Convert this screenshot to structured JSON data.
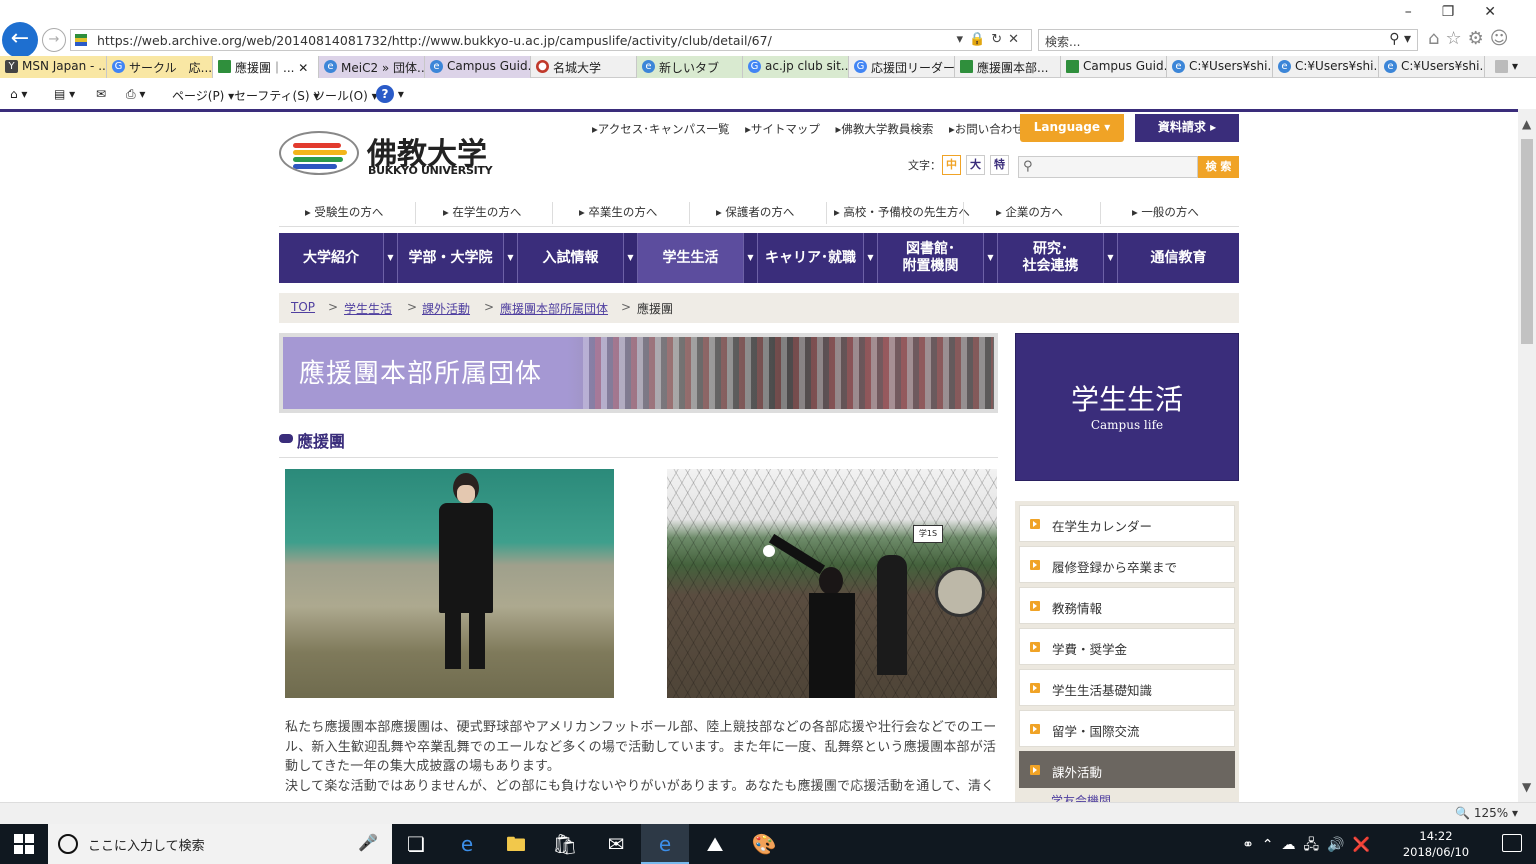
{
  "browser": {
    "url": "https://web.archive.org/web/20140814081732/http://www.bukkyo-u.ac.jp/campuslife/activity/club/detail/67/",
    "search_placeholder": "検索...",
    "tabs": [
      {
        "label": "MSN Japan - ...",
        "style": "yellow"
      },
      {
        "label": "サークル　応...",
        "style": "yellow"
      },
      {
        "label": "應援團｜...",
        "style": "active"
      },
      {
        "label": "MeiC2 » 団体...",
        "style": "purple"
      },
      {
        "label": "Campus Guid...",
        "style": "purple"
      },
      {
        "label": "名城大学",
        "style": "plain"
      },
      {
        "label": "新しいタブ",
        "style": "green"
      },
      {
        "label": "ac.jp club sit...",
        "style": "green"
      },
      {
        "label": "応援団リーダー...",
        "style": "plain"
      },
      {
        "label": "應援團本部...",
        "style": "plain"
      },
      {
        "label": "Campus Guid...",
        "style": "plain"
      },
      {
        "label": "C:¥Users¥shi...",
        "style": "plain"
      },
      {
        "label": "C:¥Users¥shi...",
        "style": "plain"
      },
      {
        "label": "C:¥Users¥shi...",
        "style": "plain"
      }
    ],
    "commands": {
      "page": "ページ(P) ▾",
      "safety": "セーフティ(S) ▾",
      "tools": "ツール(O) ▾"
    },
    "zoom": "125%"
  },
  "header": {
    "logo_jp": "佛教大学",
    "logo_en": "BUKKYO UNIVERSITY",
    "util_links": [
      "▸アクセス･キャンパス一覧",
      "▸サイトマップ",
      "▸佛教大学教員検索",
      "▸お問い合わせ"
    ],
    "language_label": "Language ▾",
    "request_label": "資料請求 ▸",
    "fontsize_label": "文字：",
    "fontsize_options": [
      "中",
      "大",
      "特"
    ],
    "search_button": "検 索"
  },
  "target_nav": [
    "▸ 受験生の方へ",
    "▸ 在学生の方へ",
    "▸ 卒業生の方へ",
    "▸ 保護者の方へ",
    "▸ 高校・予備校の先生方へ",
    "▸ 企業の方へ",
    "▸ 一般の方へ"
  ],
  "main_nav": [
    "大学紹介",
    "学部・大学院",
    "入試情報",
    "学生生活",
    "キャリア･就職",
    "図書館･\n附置機関",
    "研究･\n社会連携",
    "通信教育"
  ],
  "breadcrumb": {
    "items": [
      "TOP",
      "学生生活",
      "課外活動",
      "應援團本部所属団体"
    ],
    "current": "應援團",
    "sep": ">"
  },
  "banner_title": "應援團本部所属団体",
  "section_title": "應援團",
  "photo2_sign": "学1S",
  "body_text": [
    "私たち應援團本部應援團は、硬式野球部やアメリカンフットボール部、陸上競技部などの各部応援や壮行会などでのエール、新入生歓迎乱舞や卒業乱舞でのエールなど多くの場で活動しています。また年に一度、乱舞祭という應援團本部が活動してきた一年の集大成披露の場もあります。",
    "決して楽な活動ではありませんが、どの部にも負けないやりがいがあります。あなたも應援團で応援活動を通して、清く"
  ],
  "sidebar": {
    "title_jp": "学生生活",
    "title_en": "Campus life",
    "items": [
      "在学生カレンダー",
      "履修登録から卒業まで",
      "教務情報",
      "学費・奨学金",
      "学生生活基礎知識",
      "留学・国際交流",
      "課外活動"
    ],
    "active_index": 6,
    "sub_item": "学友会機関"
  },
  "taskbar": {
    "search_placeholder": "ここに入力して検索",
    "time": "14:22",
    "date": "2018/06/10"
  },
  "colors": {
    "brand_purple": "#3a2d7b",
    "accent_orange": "#f0a326"
  }
}
